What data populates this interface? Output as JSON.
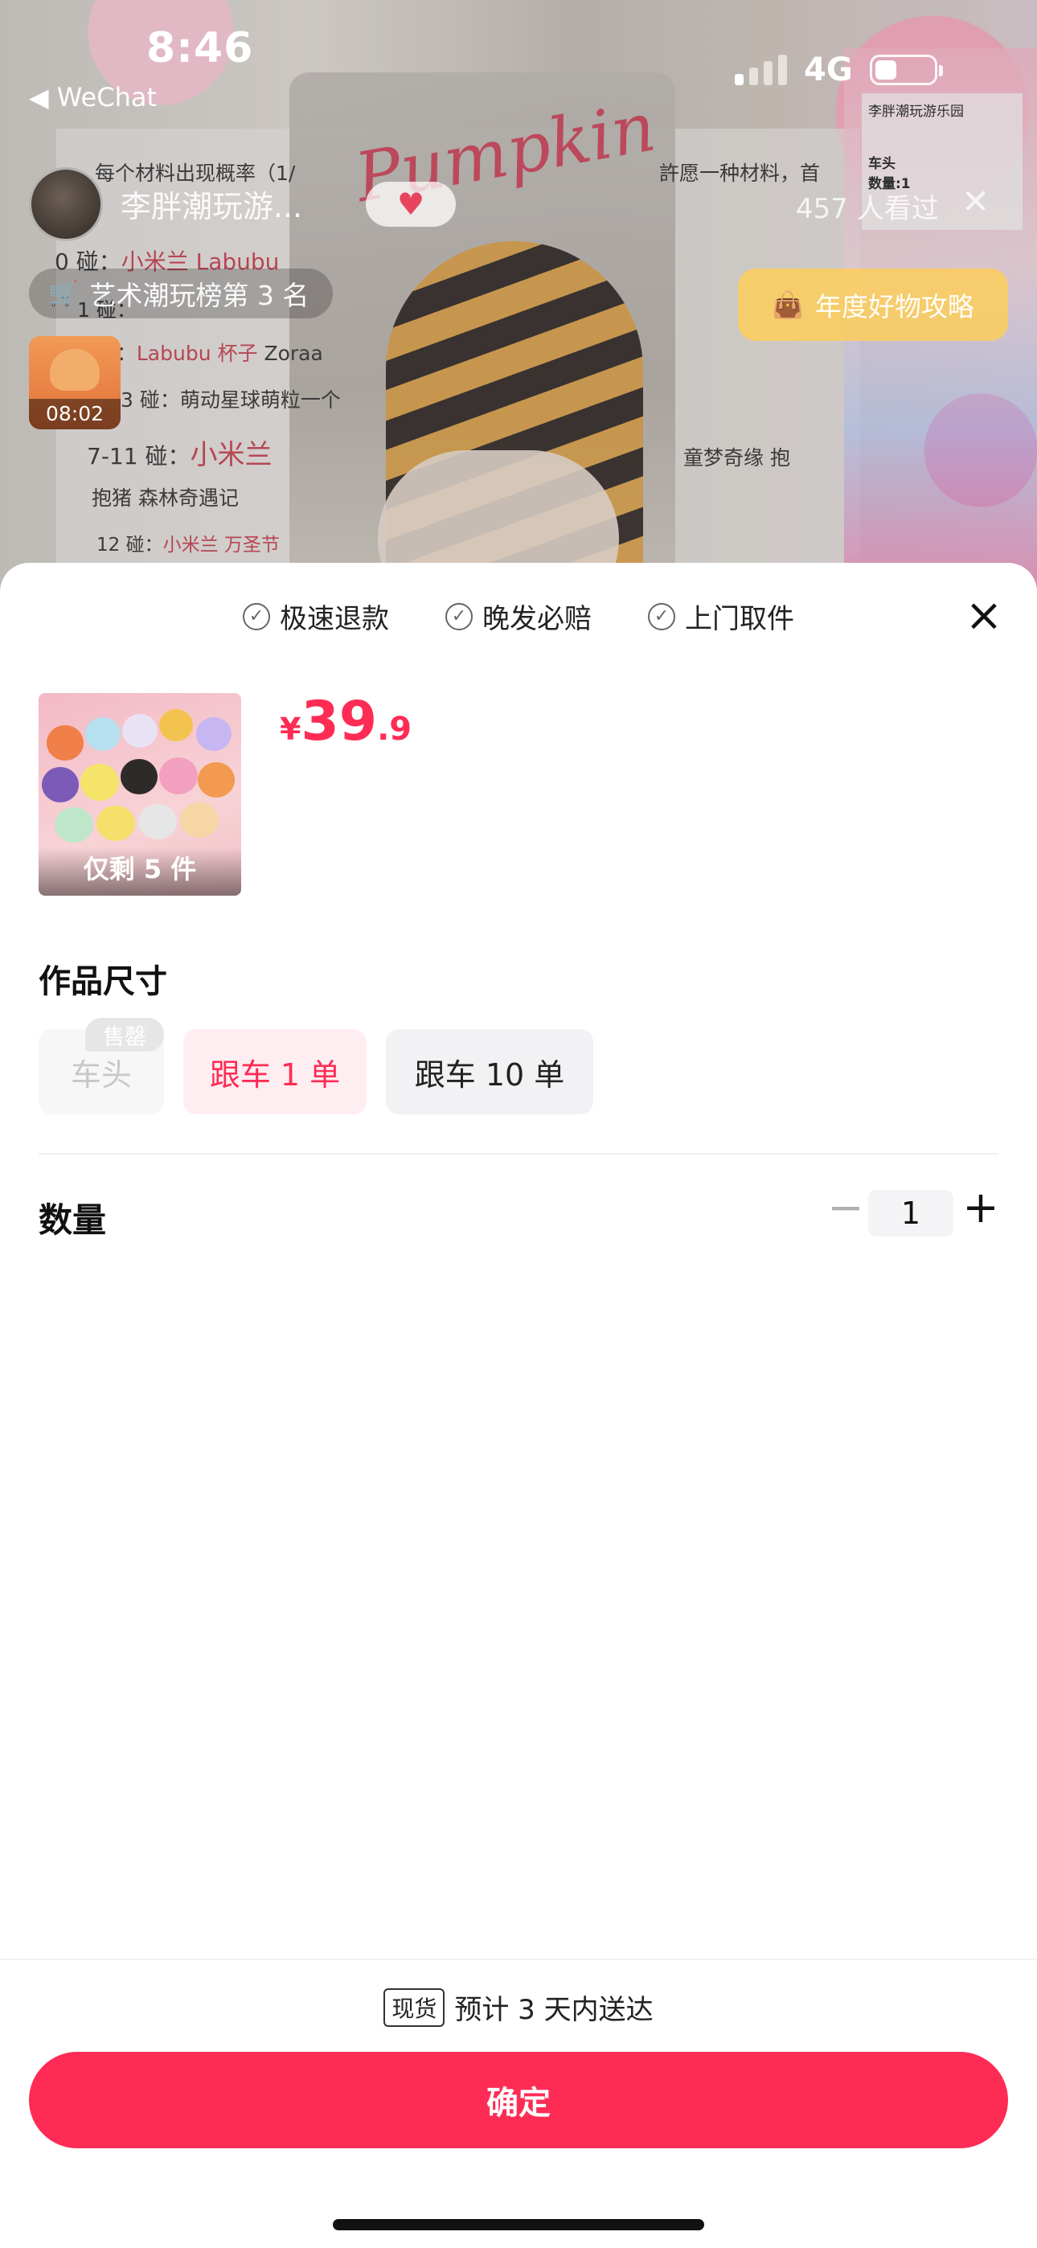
{
  "status_bar": {
    "time": "8:46",
    "back_app": "WeChat",
    "network": "4G"
  },
  "live": {
    "host_name": "李胖潮玩游...",
    "viewers": "457 人看过",
    "rank_badge": "艺术潮玩榜第 3 名",
    "guide_button": "年度好物攻略",
    "mini_timer": "08:02",
    "bg_text": {
      "line1": "每个材料出现概率（1/",
      "line1b": "許愿一种材料，首",
      "line2a": "0 碰：",
      "line2b": "小米兰 Labubu",
      "line3": "1 碰：",
      "line4a": "2 碰：",
      "line4b": "Labubu 杯子",
      "line4c": "Zoraa",
      "line5": "3 碰：萌动星球萌粒一个",
      "line6a": "7-11 碰：",
      "line6b": "小米兰",
      "line6c": "童梦奇缘 抱",
      "line7": "抱猪 森林奇遇记",
      "line8a": "12 碰：",
      "line8b": "小米兰 万圣节",
      "script_title": "Pumpkin",
      "receipt_shop": "李胖潮玩游乐园",
      "receipt_item": "车头",
      "receipt_qty": "数量:1"
    }
  },
  "sheet": {
    "guarantees": [
      "极速退款",
      "晚发必赔",
      "上门取件"
    ],
    "product": {
      "remaining": "仅剩 5 件",
      "price_currency": "¥",
      "price_int": "39",
      "price_dec": ".9"
    },
    "size_section_title": "作品尺寸",
    "options": [
      {
        "label": "车头",
        "tag": "售罄"
      },
      {
        "label": "跟车 1 单"
      },
      {
        "label": "跟车 10 单"
      }
    ],
    "quantity_label": "数量",
    "quantity_value": "1",
    "minus_symbol": "−",
    "plus_symbol": "+",
    "delivery_badge": "现货",
    "delivery_text": "预计 3 天内送达",
    "confirm_label": "确定"
  },
  "colors": {
    "accent": "#fe2c55",
    "selected_bg": "#ffeef1"
  },
  "icons": [
    "heart-icon",
    "close-icon",
    "check-circle-icon",
    "cart-icon",
    "shopping-bag-icon",
    "back-arrow-icon"
  ]
}
